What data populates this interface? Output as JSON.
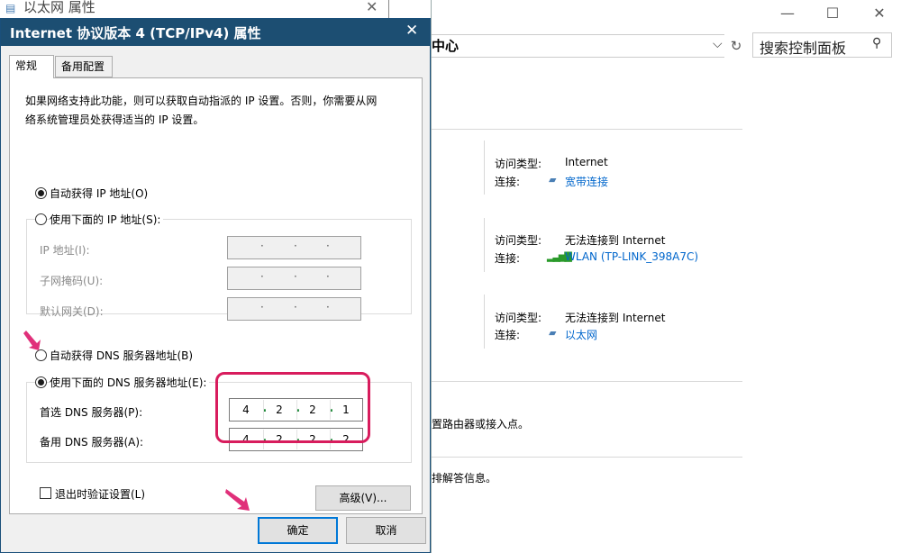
{
  "background_eth_window": {
    "title": "以太网 属性"
  },
  "network_center": {
    "address_text": "中心",
    "search_placeholder": "搜索控制面板",
    "networks": [
      {
        "access_label": "访问类型:",
        "access_value": "Internet",
        "conn_label": "连接:",
        "conn_value": "宽带连接",
        "icon": "ethernet-icon"
      },
      {
        "access_label": "访问类型:",
        "access_value": "无法连接到 Internet",
        "conn_label": "连接:",
        "conn_value": "WLAN (TP-LINK_398A7C)",
        "icon": "wifi-signal-icon"
      },
      {
        "access_label": "访问类型:",
        "access_value": "无法连接到 Internet",
        "conn_label": "连接:",
        "conn_value": "以太网",
        "icon": "ethernet-icon"
      }
    ],
    "fragment_1": "置路由器或接入点。",
    "fragment_2": "排解答信息。"
  },
  "dialog": {
    "title": "Internet 协议版本 4 (TCP/IPv4) 属性",
    "tabs": [
      "常规",
      "备用配置"
    ],
    "description_line1": "如果网络支持此功能，则可以获取自动指派的 IP 设置。否则，你需要从网",
    "description_line2": "络系统管理员处获得适当的 IP 设置。",
    "ip_auto_label": "自动获得 IP 地址(O)",
    "ip_manual_label": "使用下面的 IP 地址(S):",
    "ip_address_label": "IP 地址(I):",
    "subnet_label": "子网掩码(U):",
    "gateway_label": "默认网关(D):",
    "dns_auto_label": "自动获得 DNS 服务器地址(B)",
    "dns_manual_label": "使用下面的 DNS 服务器地址(E):",
    "preferred_dns_label": "首选 DNS 服务器(P):",
    "alternate_dns_label": "备用 DNS 服务器(A):",
    "preferred_dns": [
      "4",
      "2",
      "2",
      "1"
    ],
    "alternate_dns": [
      "4",
      "2",
      "2",
      "2"
    ],
    "validate_label": "退出时验证设置(L)",
    "advanced_label": "高级(V)...",
    "ok_label": "确定",
    "cancel_label": "取消",
    "ip_selected": "auto",
    "dns_selected": "manual",
    "validate_checked": false
  },
  "colors": {
    "title_bar": "#1c4e72",
    "highlight": "#d81c5d",
    "link": "#0066cc",
    "arrow": "#e0307a",
    "dns_dot": "#1f8a3a"
  }
}
